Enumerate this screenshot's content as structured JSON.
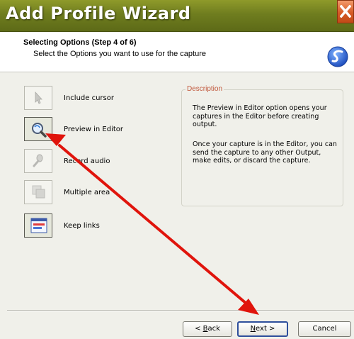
{
  "window": {
    "title": "Add Profile Wizard"
  },
  "header": {
    "step_title": "Selecting Options (Step 4 of 6)",
    "step_subtitle": "Select the Options you want to use for the capture",
    "logo_icon": "snagit-swirl-icon"
  },
  "options": [
    {
      "label": "Include cursor",
      "icon": "cursor-icon",
      "selected": false
    },
    {
      "label": "Preview in Editor",
      "icon": "magnifier-icon",
      "selected": true
    },
    {
      "label": "Record audio",
      "icon": "microphone-icon",
      "selected": false
    },
    {
      "label": "Multiple area",
      "icon": "multiple-area-icon",
      "selected": false
    },
    {
      "label": "Keep links",
      "icon": "keep-links-icon",
      "selected": true
    }
  ],
  "description": {
    "legend": "Description",
    "para1": "The Preview in Editor option opens your captures in the Editor before creating output.",
    "para2": "Once your capture is in the Editor, you can send the capture to any other Output, make edits, or discard the capture."
  },
  "buttons": {
    "back_prefix": "< ",
    "back_key": "B",
    "back_rest": "ack",
    "next_key": "N",
    "next_rest": "ext >",
    "cancel": "Cancel"
  },
  "annotation": {
    "arrow_color": "#e0140c"
  }
}
